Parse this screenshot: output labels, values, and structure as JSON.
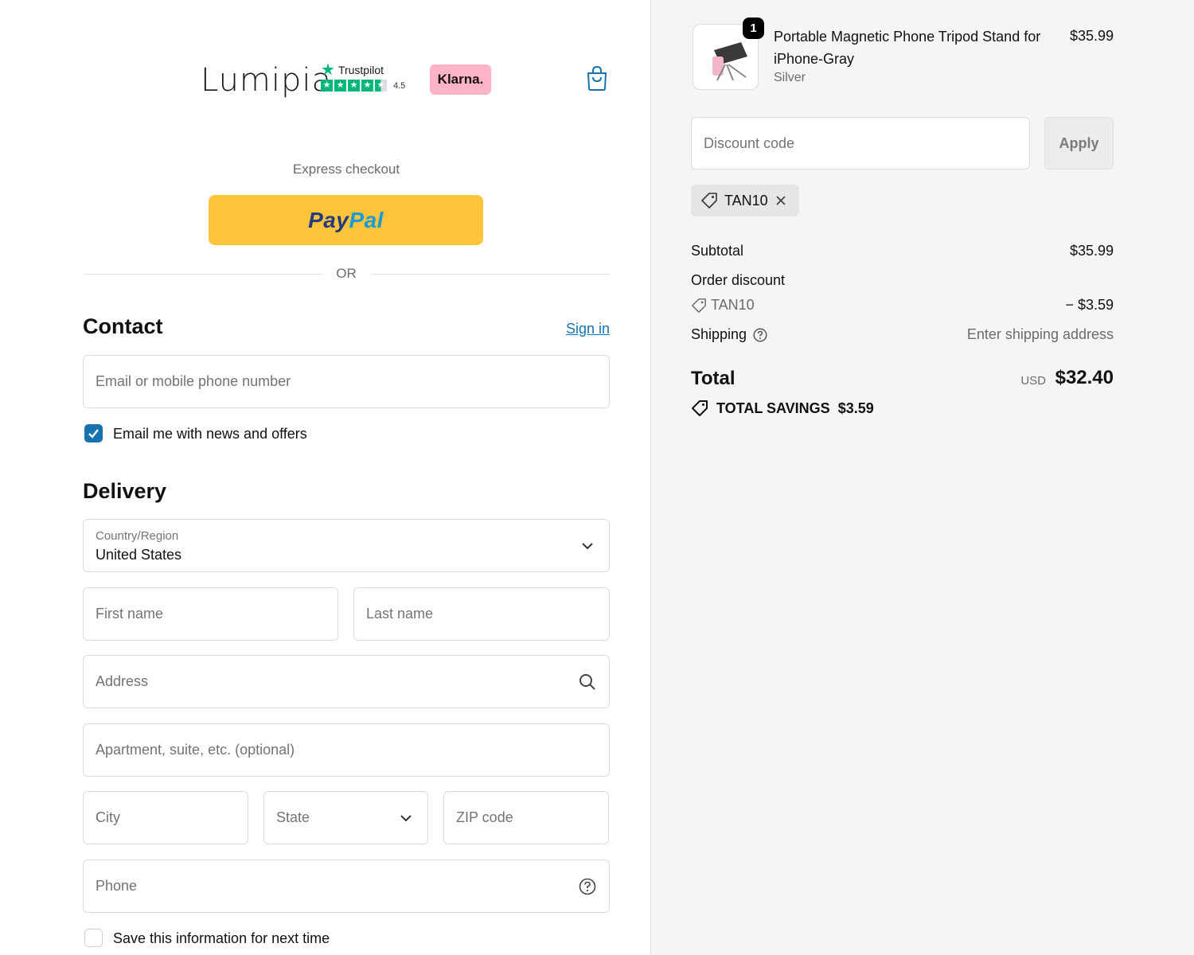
{
  "header": {
    "logo": "Lumipia",
    "trustpilot": {
      "label": "Trustpilot",
      "score": "4.5"
    },
    "klarna": "Klarna."
  },
  "express": {
    "title": "Express checkout",
    "paypal_part1": "Pay",
    "paypal_part2": "Pal",
    "or": "OR"
  },
  "contact": {
    "title": "Contact",
    "signin": "Sign in",
    "email_placeholder": "Email or mobile phone number",
    "newsletter_label": "Email me with news and offers",
    "newsletter_checked": true
  },
  "delivery": {
    "title": "Delivery",
    "country_label": "Country/Region",
    "country_value": "United States",
    "first_name": "First name",
    "last_name": "Last name",
    "address": "Address",
    "apartment": "Apartment, suite, etc. (optional)",
    "city": "City",
    "state": "State",
    "zip": "ZIP code",
    "phone": "Phone",
    "save_label": "Save this information for next time",
    "save_checked": false
  },
  "summary": {
    "item": {
      "quantity": "1",
      "name": "Portable Magnetic Phone Tripod Stand for iPhone-Gray",
      "variant": "Silver",
      "price": "$35.99"
    },
    "discount_placeholder": "Discount code",
    "apply": "Apply",
    "applied_code": "TAN10",
    "subtotal_label": "Subtotal",
    "subtotal_value": "$35.99",
    "order_discount_label": "Order discount",
    "order_discount_code": "TAN10",
    "order_discount_value": "− $3.59",
    "shipping_label": "Shipping",
    "shipping_value": "Enter shipping address",
    "total_label": "Total",
    "currency": "USD",
    "total_value": "$32.40",
    "savings_label": "TOTAL SAVINGS",
    "savings_value": "$3.59"
  },
  "colors": {
    "accent": "#1773b0",
    "paypal": "#ffc439",
    "trustpilot": "#00b67a",
    "klarna": "#ffb3c7"
  }
}
